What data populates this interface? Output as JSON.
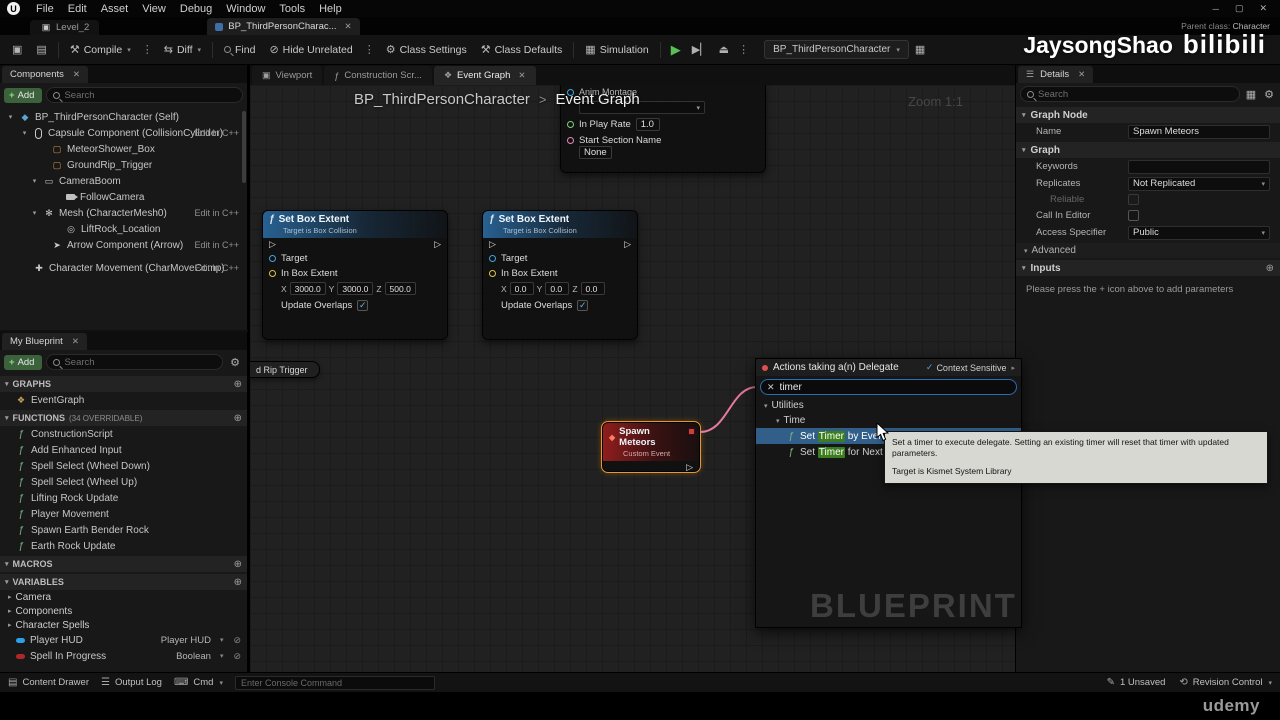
{
  "icons": {
    "logo": "U",
    "min": "─",
    "max": "▢",
    "close": "✕",
    "caret": "▾",
    "arrow_r": "▸",
    "arrow_d": "▾",
    "plus": "+",
    "plus_circle": "⊕",
    "check": "✓",
    "fn": "ƒ",
    "kebab": "⋮",
    "play": "▶",
    "skip": "▶▏",
    "eject": "⏏",
    "gear": "⚙",
    "grid": "▦",
    "hammer": "⚒",
    "diff": "⇆",
    "eye": "⊘",
    "diamond": "◆",
    "menu": "☰",
    "rows": "▤",
    "save": "▣",
    "keyboard": "⌨",
    "pencil": "✎",
    "revision": "⟲",
    "exec": "▷",
    "box": "▢",
    "mesh": "✻",
    "scene": "◎",
    "arrow_comp": "➤",
    "movement": "✚",
    "self": "◆",
    "boom": "▭",
    "graph": "❖",
    "monitor": "▣",
    "bullet": "●"
  },
  "menubar": {
    "menus": [
      "File",
      "Edit",
      "Asset",
      "View",
      "Debug",
      "Window",
      "Tools",
      "Help"
    ]
  },
  "tabrow": {
    "level_tab": "Level_2",
    "asset_tab": "BP_ThirdPersonCharac...",
    "parent_class_label": "Parent class:",
    "parent_class_value": "Character"
  },
  "toolbar": {
    "compile": "Compile",
    "diff": "Diff",
    "find": "Find",
    "hide_unrelated": "Hide Unrelated",
    "class_settings": "Class Settings",
    "class_defaults": "Class Defaults",
    "simulation": "Simulation",
    "debug_target": "BP_ThirdPersonCharacter"
  },
  "watermark": {
    "name": "JaysongShao",
    "brand": "bilibili",
    "udemy": "udemy"
  },
  "components": {
    "title": "Components",
    "add": "Add",
    "search_placeholder": "Search",
    "tree": [
      {
        "label": "BP_ThirdPersonCharacter (Self)"
      },
      {
        "label": "Capsule Component (CollisionCylinder)",
        "edit": "Edit in C++"
      },
      {
        "label": "MeteorShower_Box"
      },
      {
        "label": "GroundRip_Trigger"
      },
      {
        "label": "CameraBoom"
      },
      {
        "label": "FollowCamera"
      },
      {
        "label": "Mesh (CharacterMesh0)",
        "edit": "Edit in C++"
      },
      {
        "label": "LiftRock_Location"
      },
      {
        "label": "Arrow Component (Arrow)",
        "edit": "Edit in C++"
      },
      {
        "label": "Character Movement (CharMoveComp)",
        "edit": "Edit in C++"
      }
    ]
  },
  "my_blueprint": {
    "title": "My Blueprint",
    "add": "Add",
    "search_placeholder": "Search",
    "graphs_header": "GRAPHS",
    "graphs": [
      {
        "label": "EventGraph"
      }
    ],
    "functions_header": "FUNCTIONS",
    "functions_header_sub": "(34 OVERRIDABLE)",
    "functions": [
      {
        "label": "ConstructionScript"
      },
      {
        "label": "Add Enhanced Input"
      },
      {
        "label": "Spell Select (Wheel Down)"
      },
      {
        "label": "Spell Select (Wheel Up)"
      },
      {
        "label": "Lifting Rock Update"
      },
      {
        "label": "Player Movement"
      },
      {
        "label": "Spawn Earth Bender Rock"
      },
      {
        "label": "Earth Rock Update"
      }
    ],
    "macros_header": "MACROS",
    "variables_header": "VARIABLES",
    "categories": [
      {
        "label": "Camera"
      },
      {
        "label": "Components"
      },
      {
        "label": "Character Spells"
      }
    ],
    "variables": [
      {
        "name": "Player HUD",
        "type": "Player HUD"
      },
      {
        "name": "Spell In Progress",
        "type": "Boolean"
      }
    ]
  },
  "graph": {
    "tabs": [
      {
        "label": "Viewport"
      },
      {
        "label": "Construction Scr..."
      },
      {
        "label": "Event Graph"
      }
    ],
    "breadcrumb_root": "BP_ThirdPersonCharacter",
    "breadcrumb_sep": ">",
    "breadcrumb_current": "Event Graph",
    "zoom": "Zoom 1:1",
    "watermark": "BLUEPRINT",
    "axes": {
      "x": "X",
      "y": "Y",
      "z": "Z"
    },
    "montage_node": {
      "anim_montage": "Anim Montage",
      "in_play_rate": "In Play Rate",
      "in_play_rate_value": "1.0",
      "start_section": "Start Section Name",
      "start_section_value": "None"
    },
    "set_box_extent_a": {
      "title": "Set Box Extent",
      "subtitle": "Target is Box Collision",
      "target": "Target",
      "in_box_extent": "In Box Extent",
      "x": "3000.0",
      "y": "3000.0",
      "z": "500.0",
      "update_overlaps": "Update Overlaps"
    },
    "set_box_extent_b": {
      "title": "Set Box Extent",
      "subtitle": "Target is Box Collision",
      "target": "Target",
      "in_box_extent": "In Box Extent",
      "x": "0.0",
      "y": "0.0",
      "z": "0.0",
      "update_overlaps": "Update Overlaps"
    },
    "spawn_meteors": {
      "title": "Spawn Meteors",
      "subtitle": "Custom Event"
    },
    "grip_fragment": "d Rip Trigger"
  },
  "context_menu": {
    "title": "Actions taking a(n) Delegate",
    "context_sensitive": "Context Sensitive",
    "search_value": "timer",
    "groups": [
      {
        "label": "Utilities"
      },
      {
        "label": "Time"
      }
    ],
    "items": [
      {
        "pre": "Set ",
        "match": "Timer",
        "post": " by Event"
      },
      {
        "pre": "Set ",
        "match": "Timer",
        "post": " for Next Tick b"
      }
    ]
  },
  "tooltip": {
    "line1": "Set a timer to execute delegate. Setting an existing timer will reset that timer with updated parameters.",
    "line2": "Target is Kismet System Library"
  },
  "details": {
    "title": "Details",
    "search_placeholder": "Search",
    "graph_node_header": "Graph Node",
    "name_label": "Name",
    "name_value": "Spawn Meteors",
    "graph_header": "Graph",
    "keywords_label": "Keywords",
    "replicates_label": "Replicates",
    "replicates_value": "Not Replicated",
    "reliable_label": "Reliable",
    "call_in_editor_label": "Call In Editor",
    "access_label": "Access Specifier",
    "access_value": "Public",
    "advanced_label": "Advanced",
    "inputs_header": "Inputs",
    "inputs_hint": "Please press the + icon above to add parameters"
  },
  "statusbar": {
    "content_drawer": "Content Drawer",
    "output_log": "Output Log",
    "cmd": "Cmd",
    "console_placeholder": "Enter Console Command",
    "unsaved": "1 Unsaved",
    "revision_control": "Revision Control"
  }
}
